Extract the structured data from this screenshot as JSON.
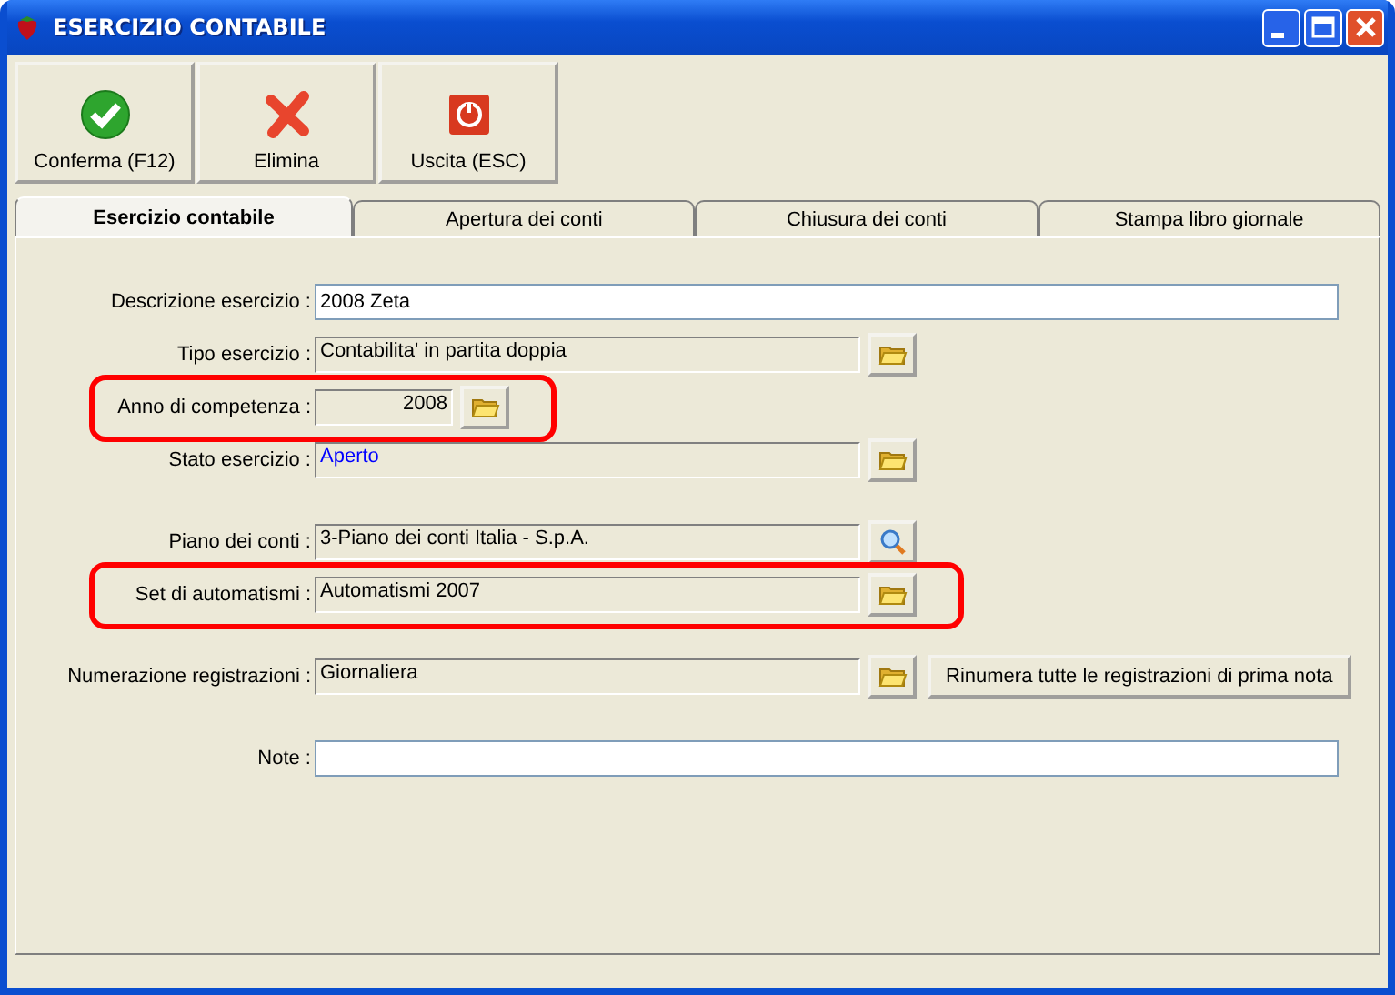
{
  "window": {
    "title": "ESERCIZIO CONTABILE"
  },
  "toolbar": [
    {
      "label": "Conferma (F12)",
      "kind": "confirm"
    },
    {
      "label": "Elimina",
      "kind": "delete"
    },
    {
      "label": "Uscita (ESC)",
      "kind": "exit"
    }
  ],
  "tabs": [
    {
      "label": "Esercizio contabile",
      "selected": true
    },
    {
      "label": "Apertura dei conti",
      "selected": false
    },
    {
      "label": "Chiusura dei conti",
      "selected": false
    },
    {
      "label": "Stampa libro giornale",
      "selected": false
    }
  ],
  "field_groups": [
    {
      "fields": [
        {
          "label": "Descrizione esercizio :",
          "kind": "entry",
          "value": "2008 Zeta",
          "highlighted": false
        },
        {
          "label": "Tipo esercizio :",
          "kind": "picker",
          "value": "Contabilita' in partita doppia",
          "highlighted": false
        },
        {
          "label": "Anno di competenza :",
          "kind": "year",
          "value": "2008",
          "highlighted": true
        },
        {
          "label": "Stato esercizio :",
          "kind": "picker",
          "value": "Aperto",
          "color": "#0000ff",
          "highlighted": false
        }
      ]
    },
    {
      "fields": [
        {
          "label": "Piano dei conti :",
          "kind": "lookup",
          "value": "3-Piano dei conti Italia - S.p.A.",
          "highlighted": false
        },
        {
          "label": "Set di automatismi :",
          "kind": "picker",
          "value": "Automatismi 2007",
          "highlighted": true
        }
      ]
    },
    {
      "fields": [
        {
          "label": "Numerazione registrazioni :",
          "kind": "picker",
          "value": "Giornaliera",
          "action": "Rinumera tutte le registrazioni di prima nota",
          "highlighted": false
        }
      ]
    },
    {
      "fields": [
        {
          "label": "Note :",
          "kind": "entry",
          "highlighted": false
        }
      ]
    }
  ]
}
